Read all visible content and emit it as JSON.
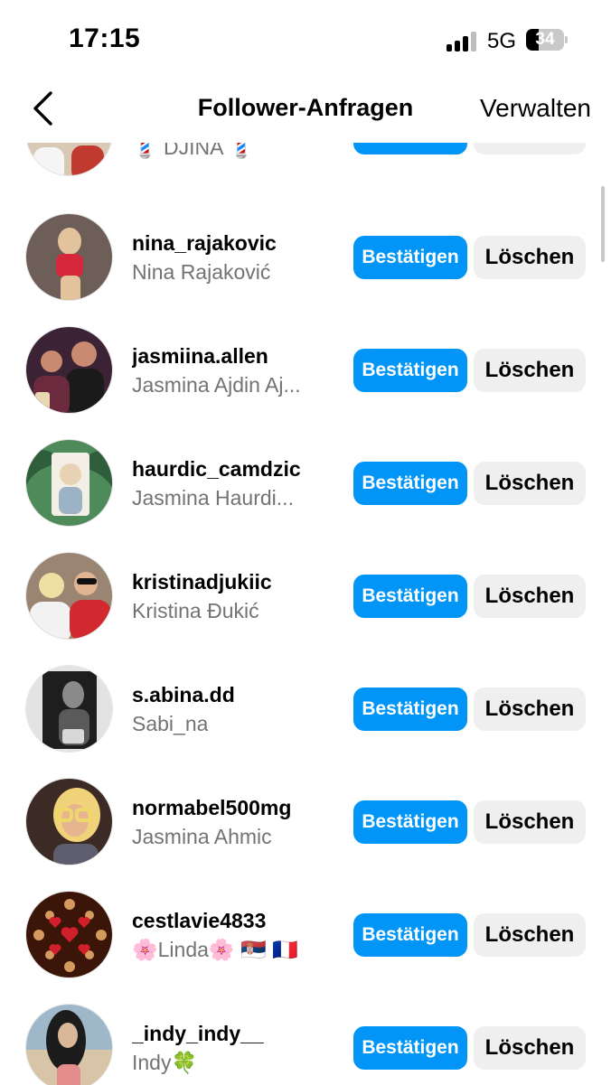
{
  "status_bar": {
    "time": "17:15",
    "network": "5G",
    "battery_level": "34",
    "battery_fraction": 0.34
  },
  "header": {
    "title": "Follower-Anfragen",
    "manage_label": "Verwalten",
    "back_icon": "chevron-left-icon"
  },
  "requests": [
    {
      "username": "",
      "fullname": "💈 DJINA 💈",
      "confirm_label": "Bestätigen",
      "delete_label": "Löschen",
      "avatar_colors": [
        "#d7c9b4",
        "#e9d49a",
        "#c13a2f"
      ]
    },
    {
      "username": "nina_rajakovic",
      "fullname": "Nina Rajaković",
      "confirm_label": "Bestätigen",
      "delete_label": "Löschen",
      "avatar_colors": [
        "#6d5e58",
        "#e2c39b",
        "#d6283a"
      ]
    },
    {
      "username": "jasmiina.allen",
      "fullname": "Jasmina Ajdin Aj...",
      "confirm_label": "Bestätigen",
      "delete_label": "Löschen",
      "avatar_colors": [
        "#3c2235",
        "#c98a72",
        "#6b2a3e"
      ]
    },
    {
      "username": "haurdic_camdzic",
      "fullname": "Jasmina Haurdi...",
      "confirm_label": "Bestätigen",
      "delete_label": "Löschen",
      "avatar_colors": [
        "#4f8a5a",
        "#e7d2b4",
        "#2e5e3c"
      ]
    },
    {
      "username": "kristinadjukiic",
      "fullname": "Kristina Đukić",
      "confirm_label": "Bestätigen",
      "delete_label": "Löschen",
      "avatar_colors": [
        "#9a8572",
        "#f2f2f2",
        "#d2282f"
      ]
    },
    {
      "username": "s.abina.dd",
      "fullname": "Sabi_na",
      "confirm_label": "Bestätigen",
      "delete_label": "Löschen",
      "avatar_colors": [
        "#e3e3e3",
        "#5a5a5a",
        "#1e1e1e"
      ]
    },
    {
      "username": "normabel500mg",
      "fullname": "Jasmina Ahmic",
      "confirm_label": "Bestätigen",
      "delete_label": "Löschen",
      "avatar_colors": [
        "#3b2b24",
        "#f0d27a",
        "#efd76a"
      ]
    },
    {
      "username": "cestlavie4833",
      "fullname": "🌸Linda🌸 🇷🇸 🇫🇷",
      "confirm_label": "Bestätigen",
      "delete_label": "Löschen",
      "avatar_colors": [
        "#3a1508",
        "#d49a5e",
        "#d21f2c"
      ]
    },
    {
      "username": "_indy_indy__",
      "fullname": "Indy🍀",
      "confirm_label": "Bestätigen",
      "delete_label": "Löschen",
      "avatar_colors": [
        "#9fb8c9",
        "#d9b89a",
        "#1c1c1c"
      ]
    }
  ]
}
